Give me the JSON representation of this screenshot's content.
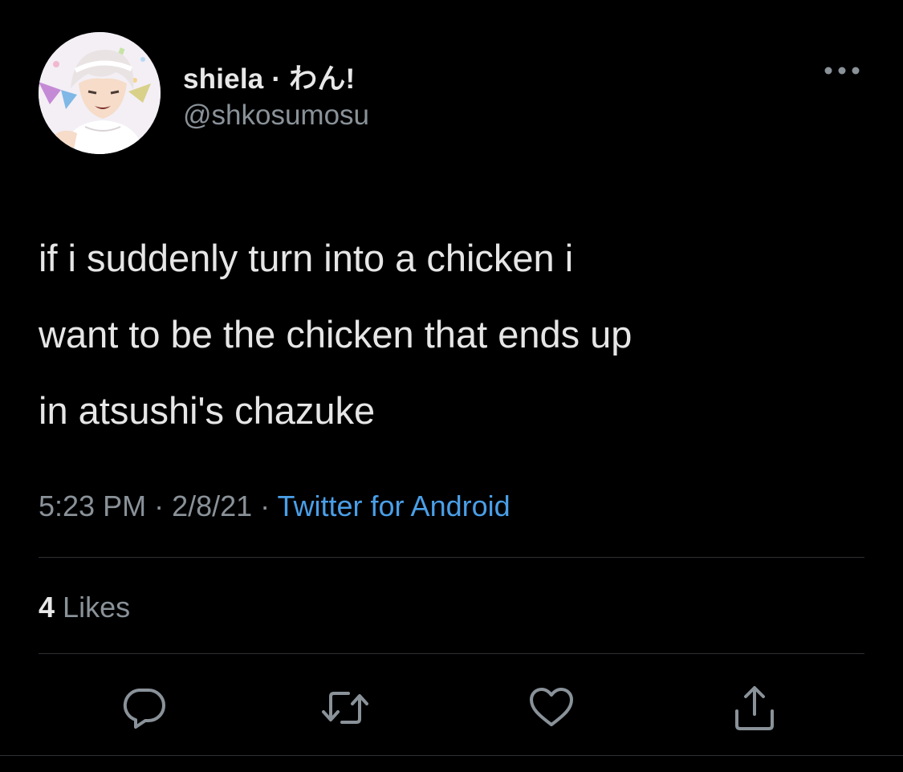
{
  "user": {
    "display_name": "shiela · わん!",
    "handle": "@shkosumosu"
  },
  "tweet": {
    "text": "if i suddenly turn into a chicken i\nwant to be the chicken that ends up\nin atsushi's chazuke"
  },
  "meta": {
    "time": "5:23 PM",
    "date": "2/8/21",
    "separator": " · ",
    "source": "Twitter for Android"
  },
  "stats": {
    "likes_count": "4",
    "likes_label": "Likes"
  },
  "actions": {
    "reply_icon": "reply-icon",
    "retweet_icon": "retweet-icon",
    "like_icon": "heart-icon",
    "share_icon": "share-icon",
    "more_icon": "more-options-icon"
  },
  "colors": {
    "background": "#000000",
    "text": "#e6e6e6",
    "secondary_text": "#8a9299",
    "link": "#4a9fe8",
    "divider": "#2d3033"
  }
}
